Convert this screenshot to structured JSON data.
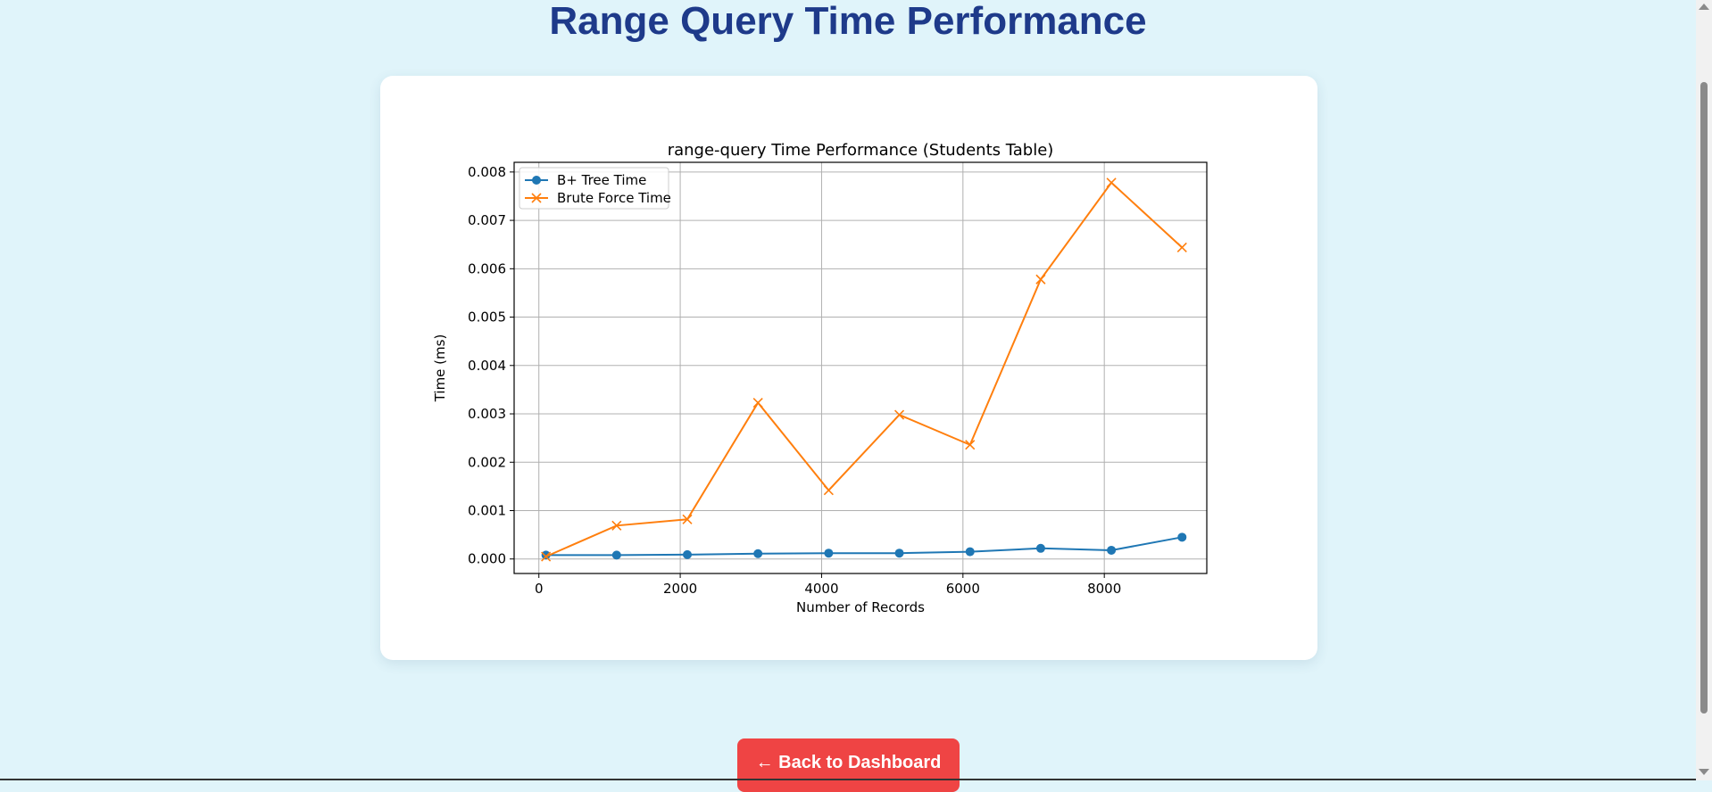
{
  "page": {
    "title": "Range Query Time Performance",
    "back_button_label": "← Back to Dashboard"
  },
  "chart_data": {
    "type": "line",
    "title": "range-query Time Performance (Students Table)",
    "xlabel": "Number of Records",
    "ylabel": "Time (ms)",
    "xlim": [
      -350,
      9450
    ],
    "ylim": [
      -0.0003,
      0.0082
    ],
    "xticks": [
      0,
      2000,
      4000,
      6000,
      8000
    ],
    "yticks": [
      0.0,
      0.001,
      0.002,
      0.003,
      0.004,
      0.005,
      0.006,
      0.007,
      0.008
    ],
    "grid": true,
    "legend_position": "upper-left",
    "x": [
      100,
      1100,
      2100,
      3100,
      4100,
      5100,
      6100,
      7100,
      8100,
      9100
    ],
    "series": [
      {
        "name": "B+ Tree Time",
        "marker": "circle",
        "color": "#1f77b4",
        "values": [
          8e-05,
          8e-05,
          9e-05,
          0.00011,
          0.00012,
          0.00012,
          0.00015,
          0.00022,
          0.00018,
          0.00045
        ]
      },
      {
        "name": "Brute Force Time",
        "marker": "x",
        "color": "#ff7f0e",
        "values": [
          5e-05,
          0.00069,
          0.00082,
          0.00323,
          0.00142,
          0.00298,
          0.00236,
          0.00578,
          0.00778,
          0.00644
        ]
      }
    ]
  }
}
